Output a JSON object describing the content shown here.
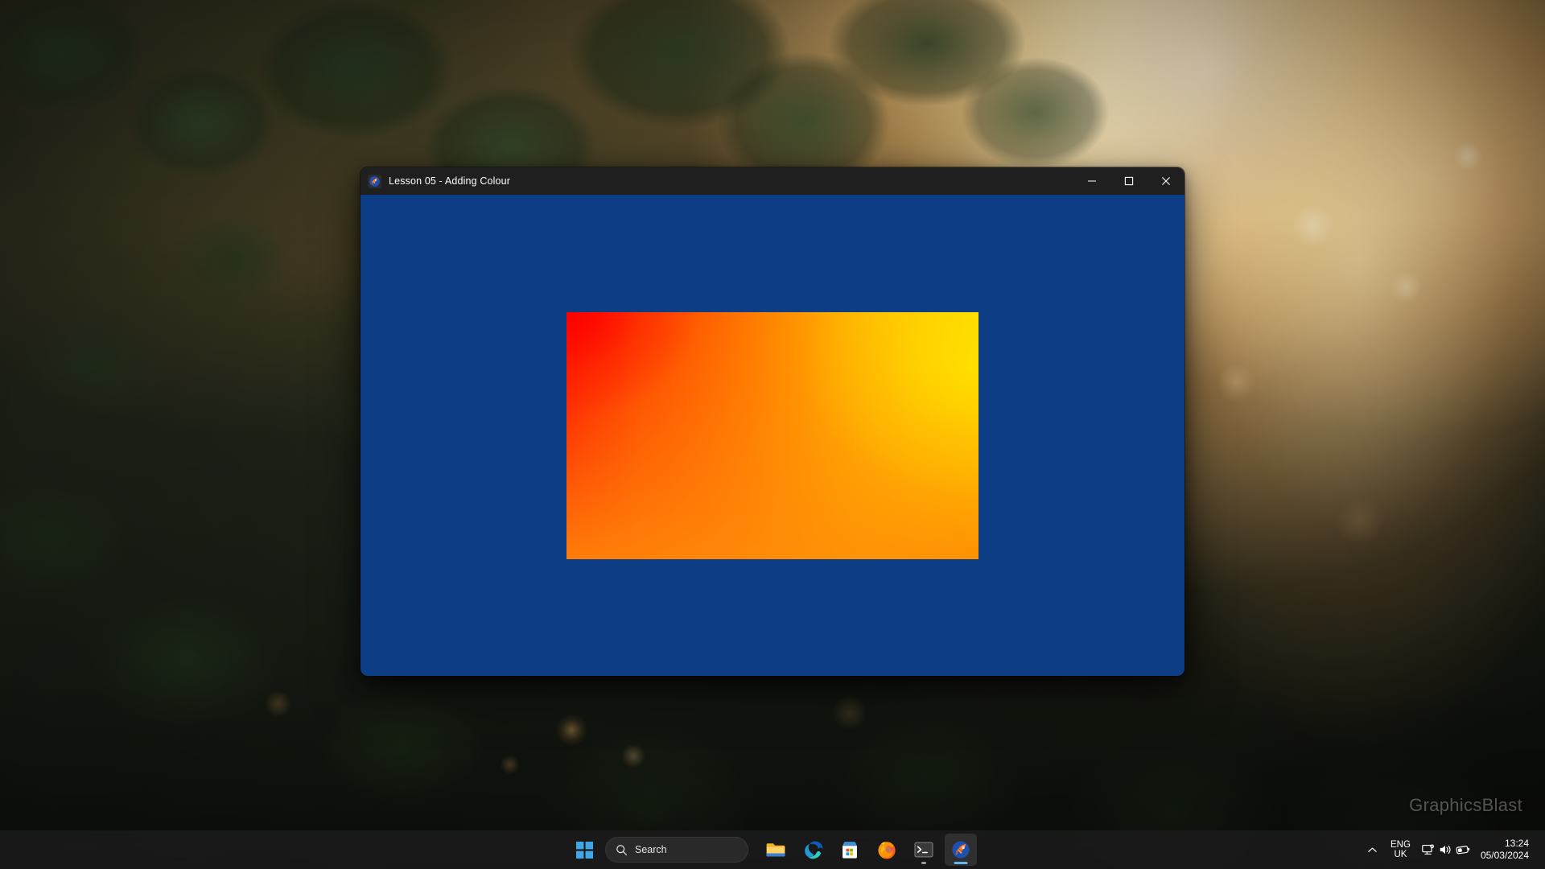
{
  "desktop": {
    "watermark": "GraphicsBlast",
    "wallpaper_description": "backlit autumn foliage at sunset"
  },
  "window": {
    "title": "Lesson 05 - Adding Colour",
    "app_icon": "rocket-icon",
    "client_background_color": "#0d3d85",
    "controls": {
      "minimize": "Minimize",
      "maximize": "Maximize",
      "close": "Close"
    },
    "canvas": {
      "name": "gradient-quad",
      "colors": {
        "top_left": "#ff0000",
        "top_right": "#ffe800",
        "bottom_left": "#ff7d09",
        "bottom_right": "#ff9103"
      }
    }
  },
  "taskbar": {
    "start_label": "Start",
    "search": {
      "label": "Search",
      "placeholder": "Search"
    },
    "items": [
      {
        "name": "file-explorer",
        "label": "File Explorer",
        "running": false,
        "active": false
      },
      {
        "name": "microsoft-edge",
        "label": "Microsoft Edge",
        "running": false,
        "active": false
      },
      {
        "name": "microsoft-store",
        "label": "Microsoft Store",
        "running": false,
        "active": false
      },
      {
        "name": "firefox",
        "label": "Firefox",
        "running": false,
        "active": false
      },
      {
        "name": "terminal",
        "label": "Terminal",
        "running": true,
        "active": false
      },
      {
        "name": "lesson-app",
        "label": "Lesson 05 - Adding Colour",
        "running": true,
        "active": true
      }
    ],
    "tray": {
      "overflow_label": "Show hidden icons",
      "language": {
        "line1": "ENG",
        "line2": "UK"
      },
      "icons": [
        "network-icon",
        "volume-icon",
        "battery-icon"
      ],
      "clock": {
        "time": "13:24",
        "date": "05/03/2024"
      }
    }
  }
}
